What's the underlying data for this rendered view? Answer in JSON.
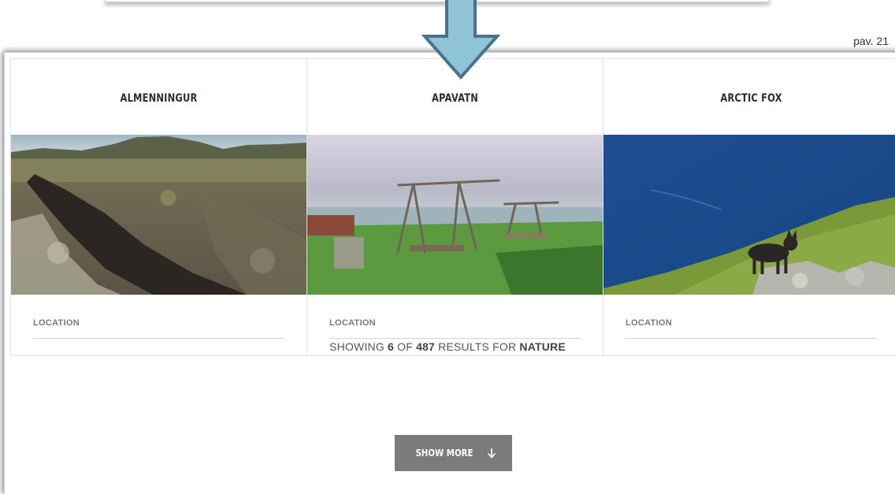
{
  "slide": {
    "page_number": "pav. 21"
  },
  "cards": [
    {
      "title": "ALMENNINGUR",
      "location_label": "LOCATION"
    },
    {
      "title": "APAVATN",
      "location_label": "LOCATION"
    },
    {
      "title": "ARCTIC FOX",
      "location_label": "LOCATION"
    }
  ],
  "results": {
    "prefix": "SHOWING",
    "shown": "6",
    "middle": "OF",
    "total": "487",
    "suffix": "RESULTS FOR",
    "query": "NATURE"
  },
  "show_more": {
    "label": "SHOW MORE",
    "icon": "arrow-down-icon"
  },
  "colors": {
    "arrow_fill": "#8fc3d6",
    "arrow_stroke": "#4a7290",
    "button_bg": "#7b7b7b"
  }
}
